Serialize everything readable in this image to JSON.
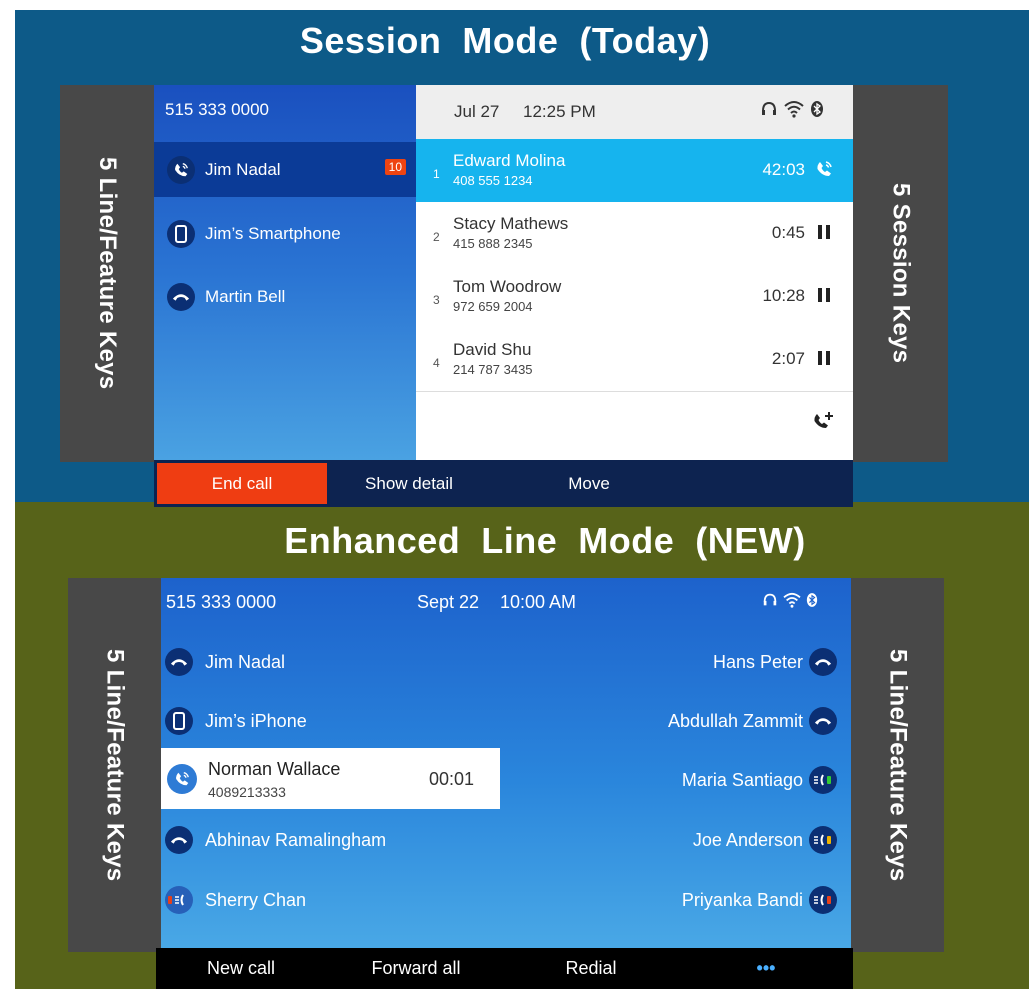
{
  "session_mode": {
    "heading": "Session  Mode  (Today)",
    "left_label": "5 Line/Feature Keys",
    "right_label": "5 Session Keys",
    "phone_number": "515 333 0000",
    "date": "Jul 27",
    "time": "12:25 PM",
    "lines": [
      {
        "label": "Jim Nadal",
        "icon": "active-call-icon",
        "badge": "10"
      },
      {
        "label": "Jim’s Smartphone",
        "icon": "smartphone-icon"
      },
      {
        "label": "Martin Bell",
        "icon": "handset-icon"
      }
    ],
    "sessions": [
      {
        "index": "1",
        "name": "Edward Molina",
        "number": "408 555 1234",
        "duration": "42:03",
        "state": "active-call-icon"
      },
      {
        "index": "2",
        "name": "Stacy Mathews",
        "number": "415 888 2345",
        "duration": "0:45",
        "state": "hold-icon"
      },
      {
        "index": "3",
        "name": "Tom Woodrow",
        "number": "972 659 2004",
        "duration": "10:28",
        "state": "hold-icon"
      },
      {
        "index": "4",
        "name": "David Shu",
        "number": "214 787 3435",
        "duration": "2:07",
        "state": "hold-icon"
      }
    ],
    "softkeys": [
      "End call",
      "Show detail",
      "Move"
    ],
    "colors": {
      "background": "#0d5a88",
      "active_session": "#16b4ee",
      "end_call": "#ef3d12"
    }
  },
  "enhanced_line_mode": {
    "heading": "Enhanced  Line  Mode  (NEW)",
    "left_label": "5 Line/Feature Keys",
    "right_label": "5 Line/Feature Keys",
    "phone_number": "515 333 0000",
    "date": "Sept 22",
    "time": "10:00 AM",
    "left_lines": [
      {
        "label": "Jim Nadal",
        "icon": "handset-icon"
      },
      {
        "label": "Jim’s iPhone",
        "icon": "smartphone-icon"
      },
      {
        "label": "Norman Wallace",
        "number": "4089213333",
        "duration": "00:01",
        "icon": "active-call-icon"
      },
      {
        "label": "Abhinav Ramalingham",
        "icon": "handset-icon"
      },
      {
        "label": "Sherry Chan",
        "icon": "presence-busy-icon"
      }
    ],
    "right_lines": [
      {
        "label": "Hans Peter",
        "icon": "handset-icon"
      },
      {
        "label": "Abdullah Zammit",
        "icon": "handset-icon"
      },
      {
        "label": "Maria Santiago",
        "icon": "presence-available-icon"
      },
      {
        "label": "Joe Anderson",
        "icon": "presence-away-icon"
      },
      {
        "label": "Priyanka Bandi",
        "icon": "presence-busy-icon"
      }
    ],
    "softkeys": [
      "New call",
      "Forward all",
      "Redial",
      "•••"
    ],
    "colors": {
      "background": "#576319",
      "presence_green": "#33cc33",
      "presence_yellow": "#f0b400",
      "presence_red": "#e8401a"
    }
  }
}
